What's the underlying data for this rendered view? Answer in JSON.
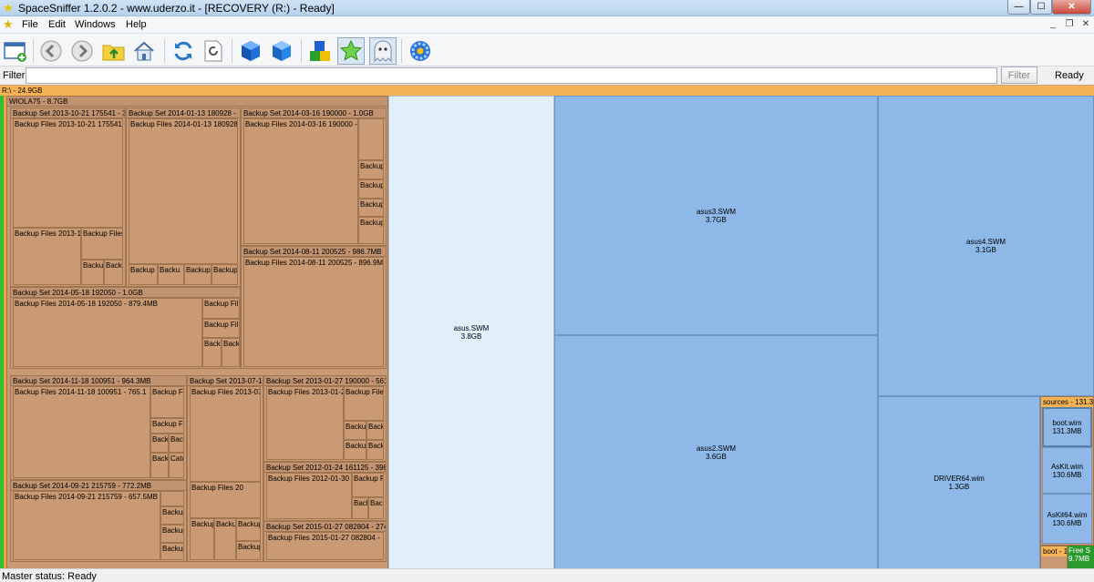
{
  "window": {
    "title": "SpaceSniffer 1.2.0.2 - www.uderzo.it - [RECOVERY (R:) - Ready]"
  },
  "menu": [
    "File",
    "Edit",
    "Windows",
    "Help"
  ],
  "toolbar": {
    "icons": [
      "new-scan-icon",
      "back-icon",
      "forward-icon",
      "parent-folder-icon",
      "home-icon",
      "refresh-icon",
      "refresh-page-icon",
      "zoom-in-cube-icon",
      "zoom-out-cube-icon",
      "blocks-icon",
      "star-icon",
      "ghost-icon",
      "settings-gear-icon"
    ]
  },
  "filter": {
    "label": "Filter",
    "value": "",
    "button": "Filter",
    "status": "Ready"
  },
  "treemap": {
    "root": "R:\\ - 24.9GB",
    "wiola": "WIOLA75 - 8.7GB",
    "sets": {
      "s1": "Backup Set 2013-10-21 175541 - 3",
      "s1f": "Backup Files 2013-10-21 175541",
      "s1a": "Backup Files 2013-1",
      "s1b": "Backup Files",
      "s1c": "Backu",
      "s1d": "Backu",
      "s2": "Backup Set 2014-01-13 180928 -",
      "s2f": "Backup Files 2014-01-13 180928",
      "s2a": "Backup F",
      "s2b": "Backu",
      "s2c": "Backup",
      "s2d": "Backup",
      "s3": "Backup Set 2014-03-16 190000 - 1.0GB",
      "s3f": "Backup Files 2014-03-16 190000 -",
      "s3a": "Backup",
      "s3b": "Backup",
      "s3c": "Backup",
      "s3d": "Backup",
      "s4": "Backup Set 2014-08-11 200525 - 986.7MB",
      "s4f": "Backup Files 2014-08-11 200525 - 896.9MB",
      "s5": "Backup Set 2014-05-18 192050 - 1.0GB",
      "s5f": "Backup Files 2014-05-18 192050 - 879.4MB",
      "s5a": "Backup Fil",
      "s5b": "Backup Fil",
      "s5c": "Back",
      "s5d": "Back",
      "s6": "Backup Set 2014-11-18 100951 - 964.3MB",
      "s6f": "Backup Files 2014-11-18 100951 - 765.1",
      "s6a": "Backup Fi",
      "s6b": "Backup Fi",
      "s6c": "Back",
      "s6d": "Back",
      "s6e": "Back",
      "s6g": "Cata",
      "s7": "Backup Set 2013-07-15",
      "s7f": "Backup Files 2013-07-",
      "s7a": "Backup Files 20",
      "s7b": "Backup",
      "s7c": "Backu",
      "s7d": "Backup",
      "s7e": "Backup",
      "s8": "Backup Set 2013-01-27 190000 - 561",
      "s8f": "Backup Files 2013-01-2",
      "s8a": "Backup Files",
      "s8b": "Backu",
      "s8c": "Backu",
      "s8d": "Backu",
      "s8e": "Backu",
      "s9": "Backup Set 2014-09-21 215759 - 772.2MB",
      "s9f": "Backup Files 2014-09-21 215759 - 657.5MB",
      "s9a": "Backup",
      "s9b": "Backup",
      "s9c": "Backup",
      "s9d": "Backup",
      "s10": "Backup Set 2012-01-24 161125 - 396",
      "s10f": "Backup Files 2012-01-30",
      "s10a": "Backup Fi",
      "s10b": "Back",
      "s10c": "Back",
      "s11": "Backup Set 2015-01-27 082804 - 274",
      "s11f": "Backup Files 2015-01-27 082804 -"
    },
    "files": {
      "asus": {
        "name": "asus.SWM",
        "size": "3.8GB"
      },
      "asus3": {
        "name": "asus3.SWM",
        "size": "3.7GB"
      },
      "asus4": {
        "name": "asus4.SWM",
        "size": "3.1GB"
      },
      "asus2": {
        "name": "asus2.SWM",
        "size": "3.6GB"
      },
      "driver64": {
        "name": "DRIVER64.wim",
        "size": "1.3GB"
      },
      "sources": "sources - 131.3",
      "boot": {
        "name": "boot.wim",
        "size": "131.3MB"
      },
      "askit": {
        "name": "AsKit.wim",
        "size": "130.6MB"
      },
      "askit64": {
        "name": "AsKit64.wim",
        "size": "130.6MB"
      },
      "bootdir": "boot - 1",
      "free": {
        "name": "Free S",
        "size": "9.7MB"
      }
    }
  },
  "status": {
    "text": "Master status: Ready"
  },
  "colors": {
    "folder": "#c99a73",
    "file": "#8db8e8",
    "selected_file": "#e1effb",
    "header": "#f6b355",
    "free": "#2a9a2e"
  }
}
